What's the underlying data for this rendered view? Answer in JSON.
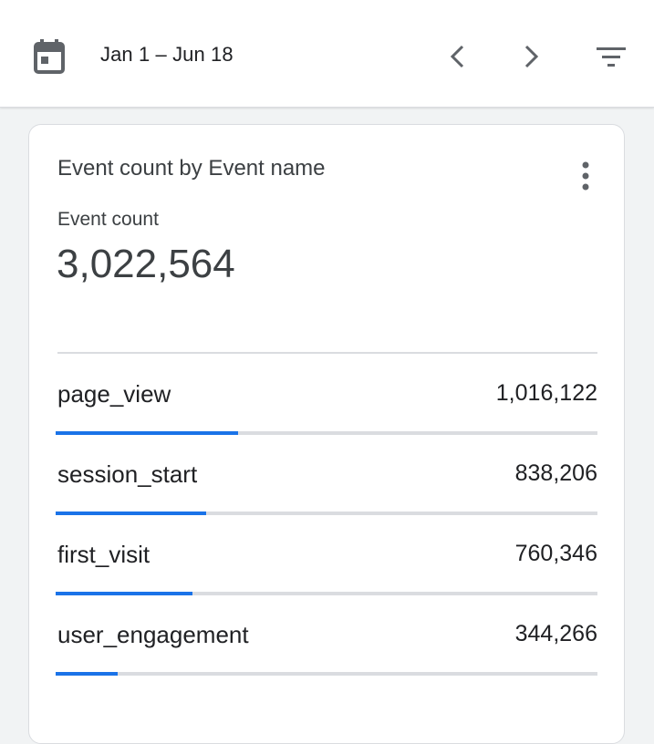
{
  "header": {
    "date_range": "Jan 1 – Jun 18",
    "icons": {
      "calendar": "calendar-icon",
      "prev": "chevron-left-icon",
      "next": "chevron-right-icon",
      "filter": "filter-icon"
    }
  },
  "card": {
    "title": "Event count by Event name",
    "metric_label": "Event count",
    "metric_value": "3,022,564",
    "menu_icon": "more-vert-icon",
    "rows": [
      {
        "name": "page_view",
        "value": "1,016,122",
        "share": 0.336
      },
      {
        "name": "session_start",
        "value": "838,206",
        "share": 0.277
      },
      {
        "name": "first_visit",
        "value": "760,346",
        "share": 0.252
      },
      {
        "name": "user_engagement",
        "value": "344,266",
        "share": 0.114
      }
    ]
  },
  "colors": {
    "accent": "#1a73e8",
    "track": "#dadce0",
    "icon": "#5f6368"
  }
}
